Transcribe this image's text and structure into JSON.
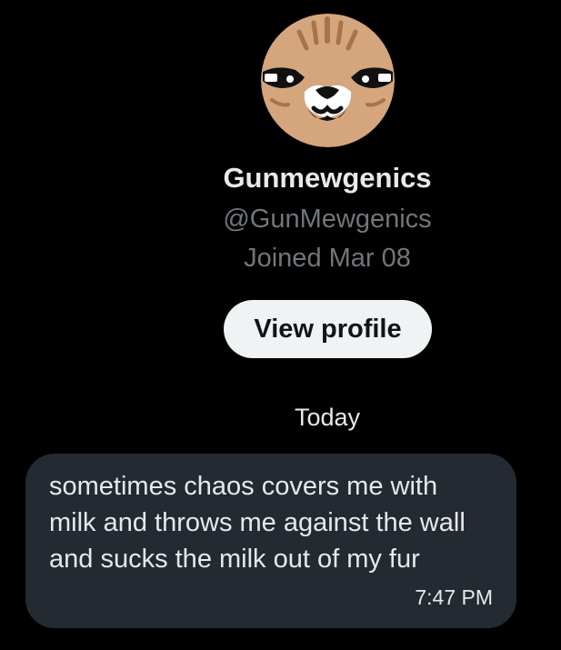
{
  "profile": {
    "avatar_icon": "tabby-cat-face-avatar",
    "display_name": "Gunmewgenics",
    "handle": "@GunMewgenics",
    "joined": "Joined Mar 08",
    "view_profile_label": "View profile"
  },
  "conversation": {
    "date_separator": "Today",
    "messages": [
      {
        "text": "sometimes chaos covers me with milk and throws me against the wall and sucks the milk out of my fur",
        "time": "7:47 PM"
      }
    ]
  },
  "colors": {
    "background": "#000000",
    "primary_text": "#e7e9ea",
    "secondary_text": "#71767b",
    "button_bg": "#eff3f4",
    "bubble_bg": "#232a31"
  }
}
